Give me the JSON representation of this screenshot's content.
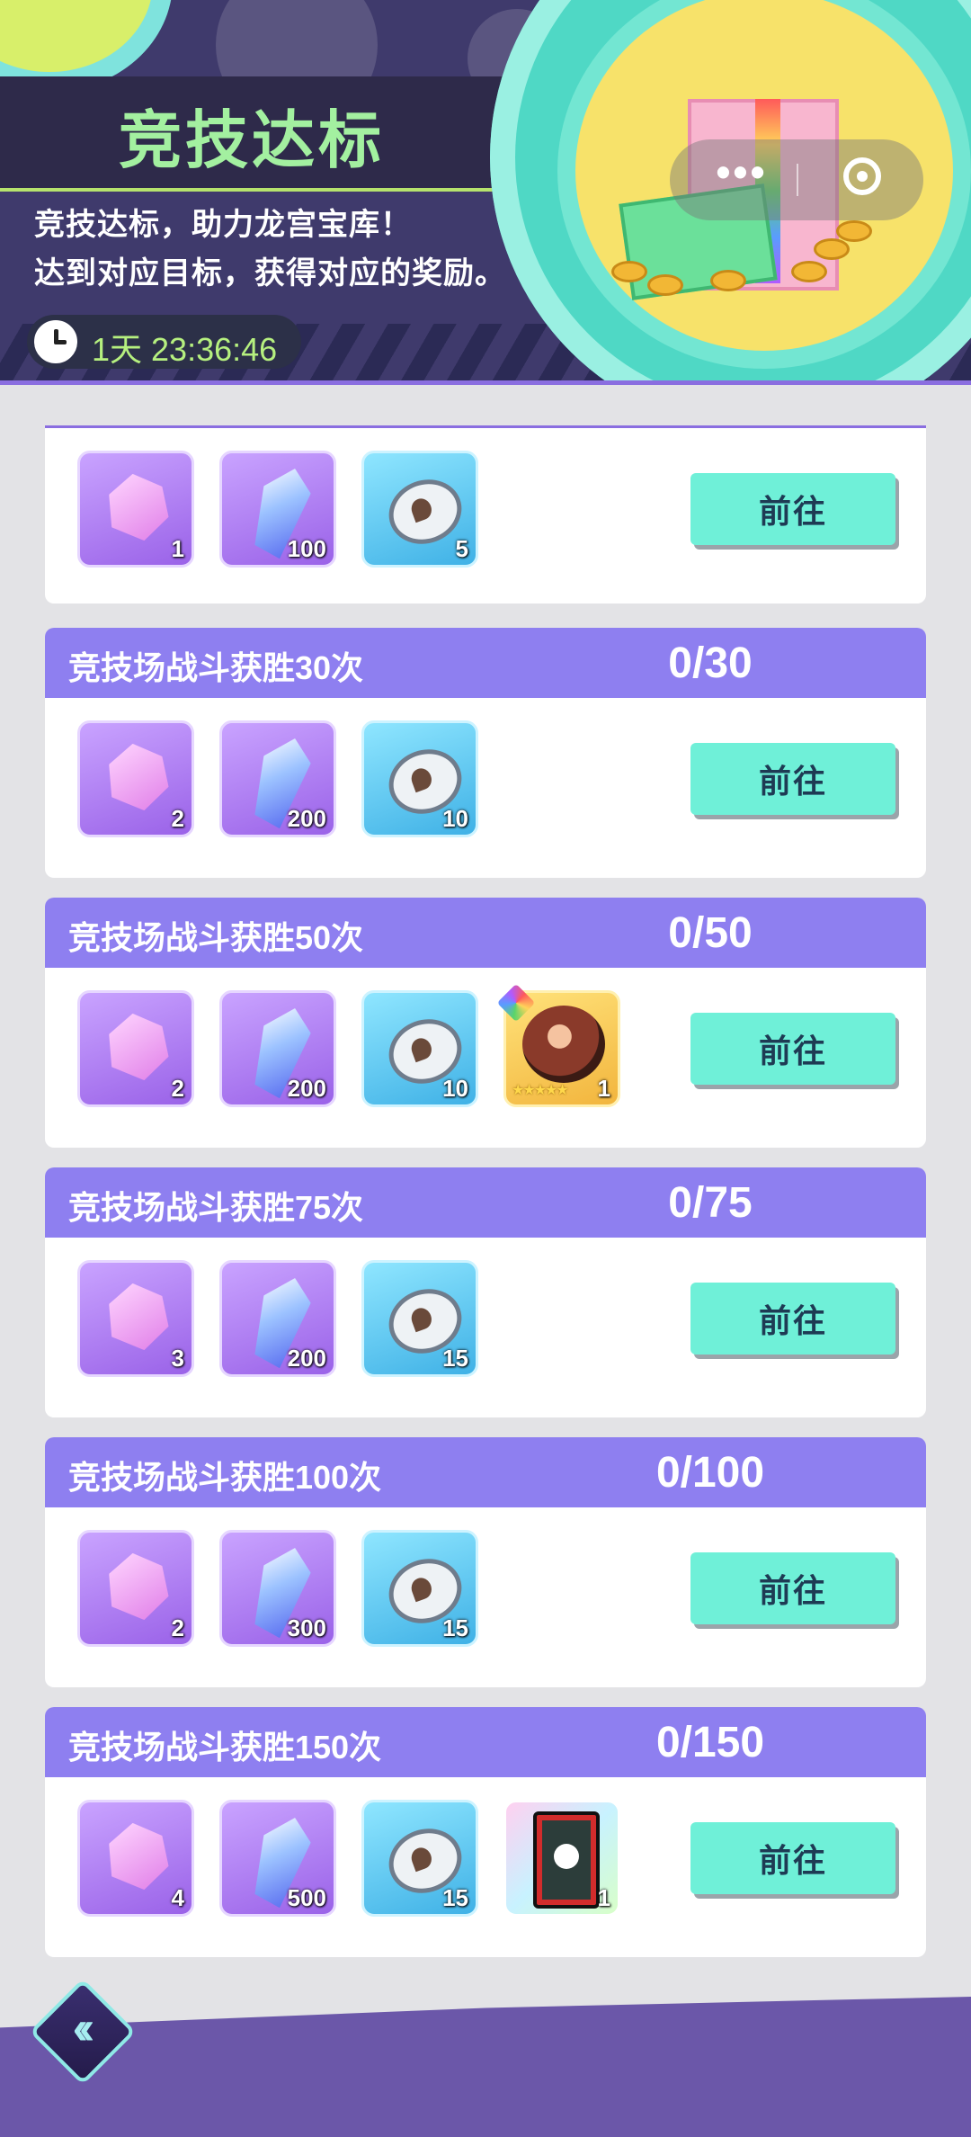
{
  "header": {
    "title": "竞技达标",
    "desc_line1": "竞技达标，助力龙宫宝库！",
    "desc_line2": "达到对应目标，获得对应的奖励。",
    "timer": "1天 23:36:46"
  },
  "wechat_capsule": {
    "more_icon": "more-dots-icon",
    "close_icon": "target-close-icon"
  },
  "go_label": "前往",
  "tasks": [
    {
      "title": "",
      "progress": "",
      "rewards": [
        {
          "type": "pink-gem",
          "qty": "1"
        },
        {
          "type": "blue-crystal",
          "qty": "100"
        },
        {
          "type": "silver-coin",
          "qty": "5"
        }
      ]
    },
    {
      "title": "竞技场战斗获胜30次",
      "progress": "0/30",
      "rewards": [
        {
          "type": "pink-gem",
          "qty": "2"
        },
        {
          "type": "blue-crystal",
          "qty": "200"
        },
        {
          "type": "silver-coin",
          "qty": "10"
        }
      ]
    },
    {
      "title": "竞技场战斗获胜50次",
      "progress": "0/50",
      "rewards": [
        {
          "type": "pink-gem",
          "qty": "2"
        },
        {
          "type": "blue-crystal",
          "qty": "200"
        },
        {
          "type": "silver-coin",
          "qty": "10"
        },
        {
          "type": "hero-portrait",
          "qty": "1"
        }
      ]
    },
    {
      "title": "竞技场战斗获胜75次",
      "progress": "0/75",
      "rewards": [
        {
          "type": "pink-gem",
          "qty": "3"
        },
        {
          "type": "blue-crystal",
          "qty": "200"
        },
        {
          "type": "silver-coin",
          "qty": "15"
        }
      ]
    },
    {
      "title": "竞技场战斗获胜100次",
      "progress": "0/100",
      "rewards": [
        {
          "type": "pink-gem",
          "qty": "2"
        },
        {
          "type": "blue-crystal",
          "qty": "300"
        },
        {
          "type": "silver-coin",
          "qty": "15"
        }
      ]
    },
    {
      "title": "竞技场战斗获胜150次",
      "progress": "0/150",
      "rewards": [
        {
          "type": "pink-gem",
          "qty": "4"
        },
        {
          "type": "blue-crystal",
          "qty": "500"
        },
        {
          "type": "silver-coin",
          "qty": "15"
        },
        {
          "type": "crown-card",
          "qty": "1"
        }
      ]
    }
  ],
  "footer": {
    "back_icon": "double-chevron-left-icon"
  },
  "colors": {
    "header_bg": "#3f3a6c",
    "title_green": "#a3f0a0",
    "card_header": "#8e7ff0",
    "go_button": "#6ff0d8",
    "footer_purple": "#6b57a9"
  }
}
